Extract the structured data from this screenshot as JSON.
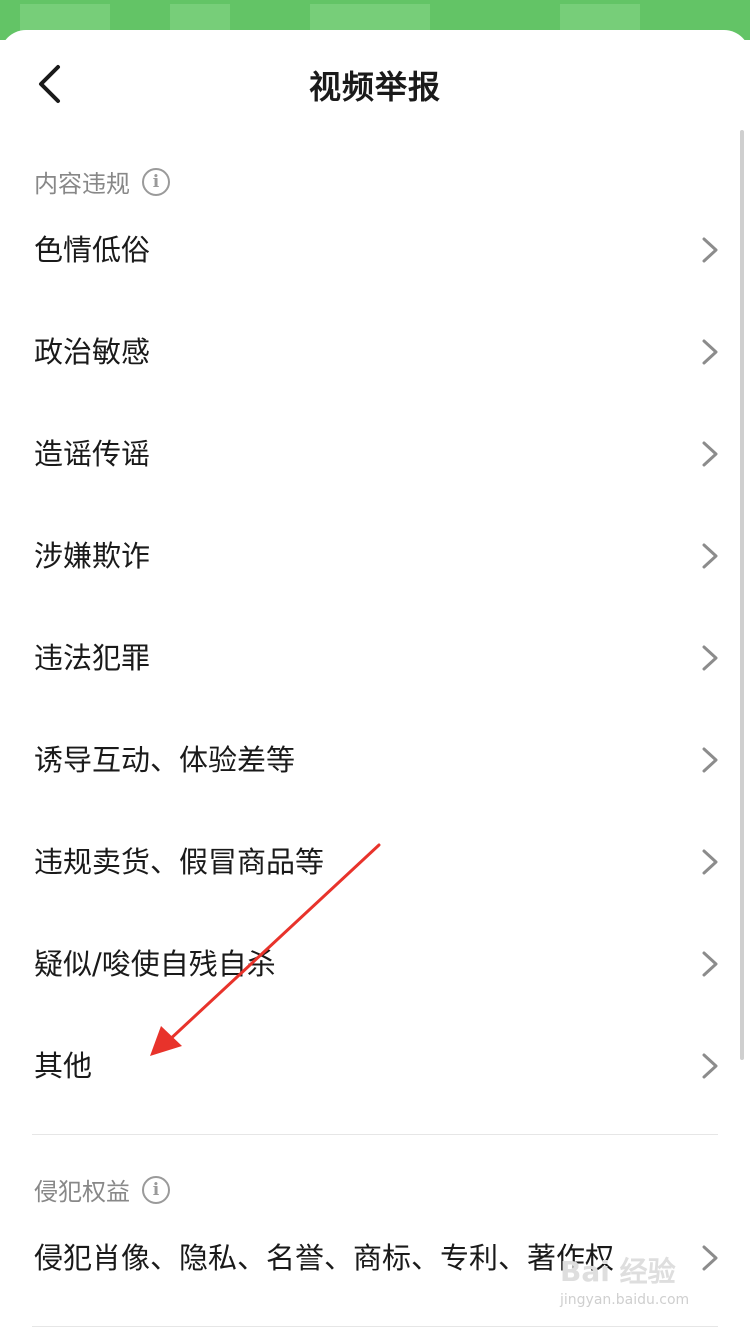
{
  "header": {
    "title": "视频举报",
    "back_icon": "back-arrow-icon"
  },
  "sections": [
    {
      "title": "内容违规",
      "items": [
        {
          "label": "色情低俗"
        },
        {
          "label": "政治敏感"
        },
        {
          "label": "造谣传谣"
        },
        {
          "label": "涉嫌欺诈"
        },
        {
          "label": "违法犯罪"
        },
        {
          "label": "诱导互动、体验差等"
        },
        {
          "label": "违规卖货、假冒商品等"
        },
        {
          "label": "疑似/唆使自残自杀"
        },
        {
          "label": "其他"
        }
      ]
    },
    {
      "title": "侵犯权益",
      "items": [
        {
          "label": "侵犯肖像、隐私、名誉、商标、专利、著作权"
        }
      ]
    }
  ],
  "watermark": {
    "logo": "Bai 经验",
    "url": "jingyan.baidu.com"
  },
  "colors": {
    "status_bar": "#63c466",
    "annotation_arrow": "#e8332b",
    "section_text": "#888888"
  }
}
